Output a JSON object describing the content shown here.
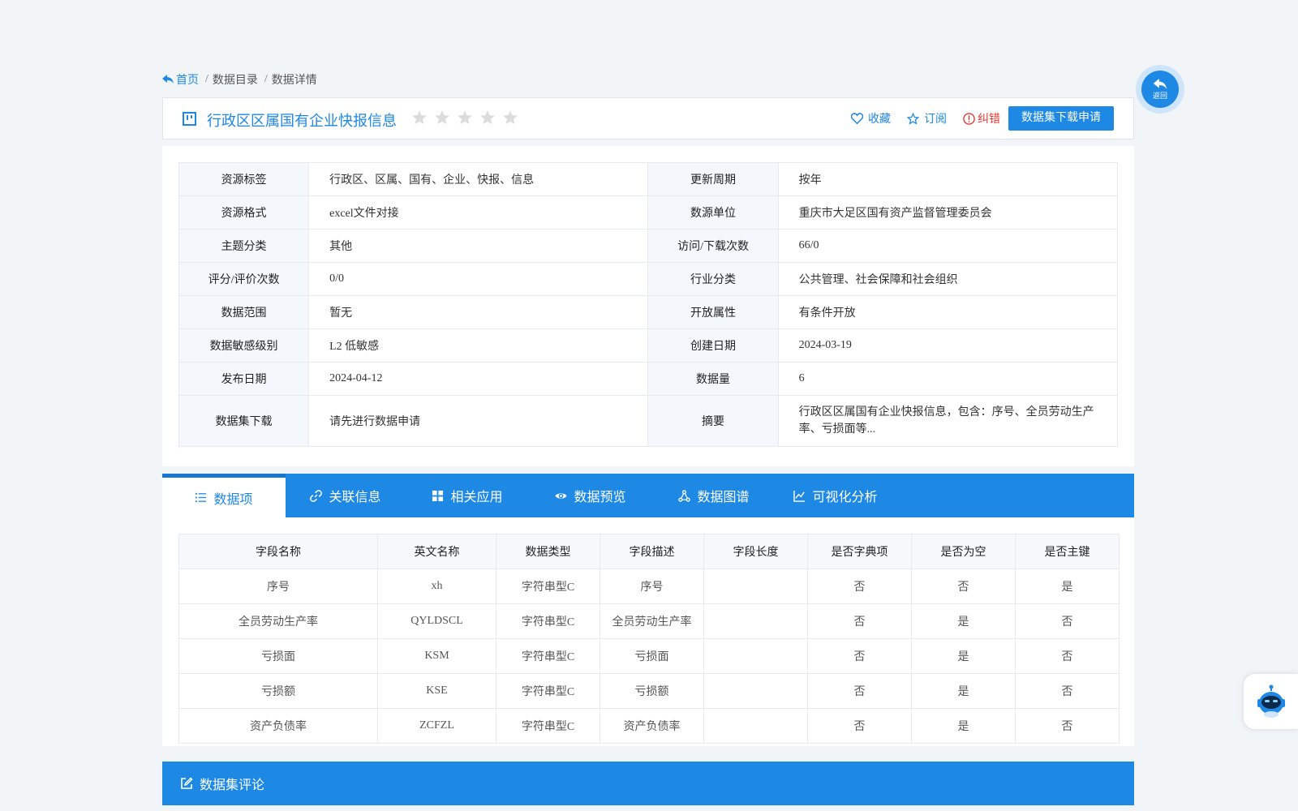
{
  "breadcrumb": {
    "home": "首页",
    "sep": "/",
    "catalog": "数据目录",
    "detail": "数据详情"
  },
  "header": {
    "title": "行政区区属国有企业快报信息",
    "rating": {
      "stars_total": 5,
      "stars_filled": 0
    },
    "favorite": "收藏",
    "subscribe": "订阅",
    "report": "纠错",
    "download_apply": "数据集下载申请"
  },
  "info": {
    "rows": [
      {
        "l1": "资源标签",
        "v1": "行政区、区属、国有、企业、快报、信息",
        "l2": "更新周期",
        "v2": "按年"
      },
      {
        "l1": "资源格式",
        "v1": "excel文件对接",
        "l2": "数源单位",
        "v2": "重庆市大足区国有资产监督管理委员会"
      },
      {
        "l1": "主题分类",
        "v1": "其他",
        "l2": "访问/下载次数",
        "v2": "66/0"
      },
      {
        "l1": "评分/评价次数",
        "v1": "0/0",
        "l2": "行业分类",
        "v2": "公共管理、社会保障和社会组织"
      },
      {
        "l1": "数据范围",
        "v1": "暂无",
        "l2": "开放属性",
        "v2": "有条件开放"
      },
      {
        "l1": "数据敏感级别",
        "v1": "L2 低敏感",
        "l2": "创建日期",
        "v2": "2024-03-19"
      },
      {
        "l1": "发布日期",
        "v1": "2024-04-12",
        "l2": "数据量",
        "v2": "6"
      },
      {
        "l1": "数据集下载",
        "v1": "请先进行数据申请",
        "l2": "摘要",
        "v2": "行政区区属国有企业快报信息，包含：序号、全员劳动生产率、亏损面等..."
      }
    ]
  },
  "tabs": [
    "数据项",
    "关联信息",
    "相关应用",
    "数据预览",
    "数据图谱",
    "可视化分析"
  ],
  "fields": {
    "headers": [
      "字段名称",
      "英文名称",
      "数据类型",
      "字段描述",
      "字段长度",
      "是否字典项",
      "是否为空",
      "是否主键"
    ],
    "rows": [
      [
        "序号",
        "xh",
        "字符串型C",
        "序号",
        "",
        "否",
        "否",
        "是"
      ],
      [
        "全员劳动生产率",
        "QYLDSCL",
        "字符串型C",
        "全员劳动生产率",
        "",
        "否",
        "是",
        "否"
      ],
      [
        "亏损面",
        "KSM",
        "字符串型C",
        "亏损面",
        "",
        "否",
        "是",
        "否"
      ],
      [
        "亏损额",
        "KSE",
        "字符串型C",
        "亏损额",
        "",
        "否",
        "是",
        "否"
      ],
      [
        "资产负债率",
        "ZCFZL",
        "字符串型C",
        "资产负债率",
        "",
        "否",
        "是",
        "否"
      ]
    ]
  },
  "comments": {
    "title": "数据集评论"
  },
  "float": {
    "back_label": "返回"
  },
  "colors": {
    "primary": "#1e88e5",
    "danger": "#e53935",
    "star_empty": "#dcdcdc"
  }
}
